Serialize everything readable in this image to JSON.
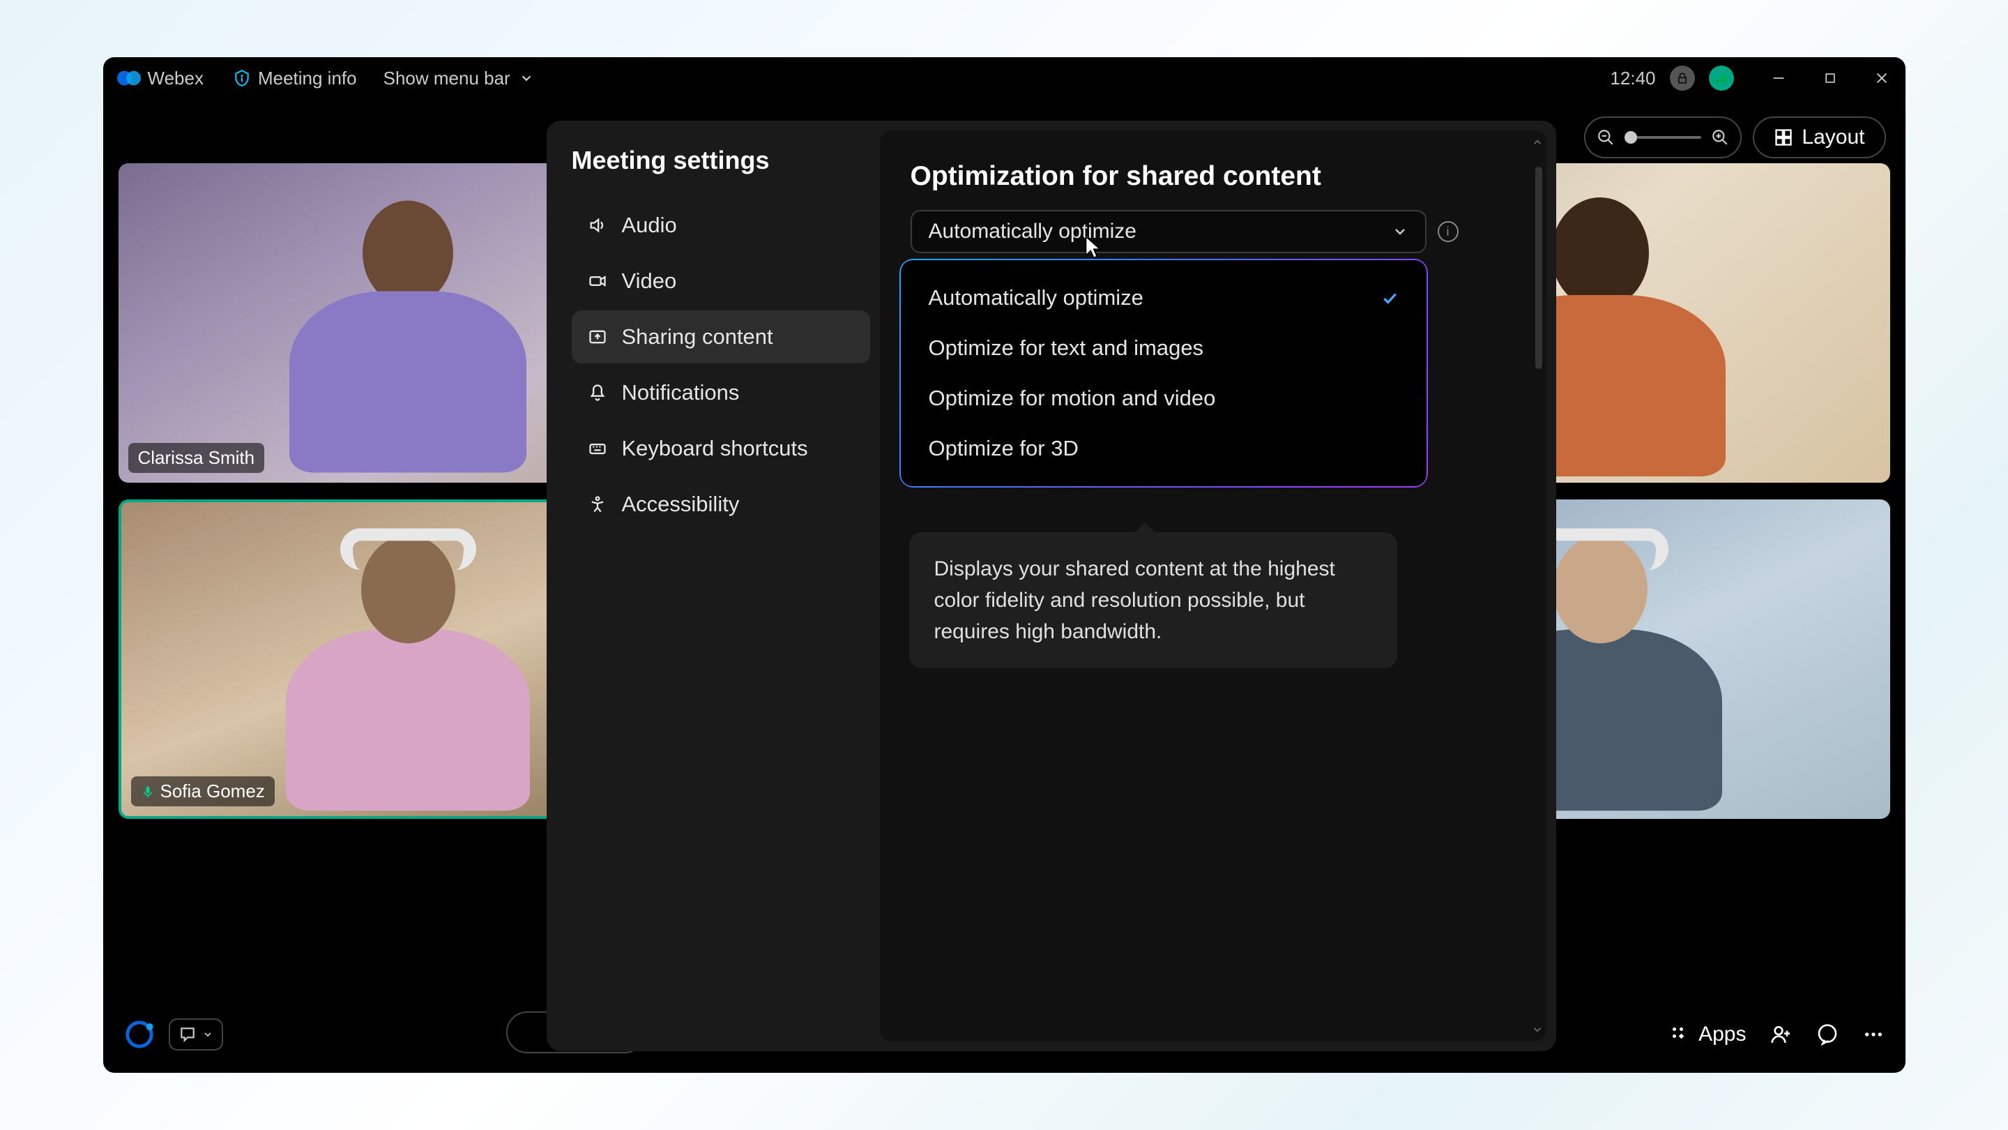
{
  "app_name": "Webex",
  "titlebar": {
    "meeting_info": "Meeting info",
    "show_menu": "Show menu bar",
    "clock": "12:40"
  },
  "toolbar": {
    "layout": "Layout"
  },
  "participants": [
    {
      "name": "Clarissa Smith"
    },
    {
      "name": "Sofia Gomez"
    }
  ],
  "bottom": {
    "apps": "Apps"
  },
  "modal": {
    "title": "Meeting settings",
    "nav": [
      {
        "label": "Audio",
        "icon": "speaker"
      },
      {
        "label": "Video",
        "icon": "camera"
      },
      {
        "label": "Sharing content",
        "icon": "share",
        "active": true
      },
      {
        "label": "Notifications",
        "icon": "bell"
      },
      {
        "label": "Keyboard shortcuts",
        "icon": "keyboard"
      },
      {
        "label": "Accessibility",
        "icon": "accessibility"
      }
    ],
    "section_title": "Optimization for shared content",
    "select_value": "Automatically optimize",
    "options": [
      {
        "label": "Automatically optimize",
        "selected": true
      },
      {
        "label": "Optimize for text and images"
      },
      {
        "label": "Optimize for motion and video"
      },
      {
        "label": "Optimize for 3D"
      }
    ],
    "tooltip": "Displays your shared content at the highest color fidelity and resolution possible, but requires high bandwidth."
  }
}
